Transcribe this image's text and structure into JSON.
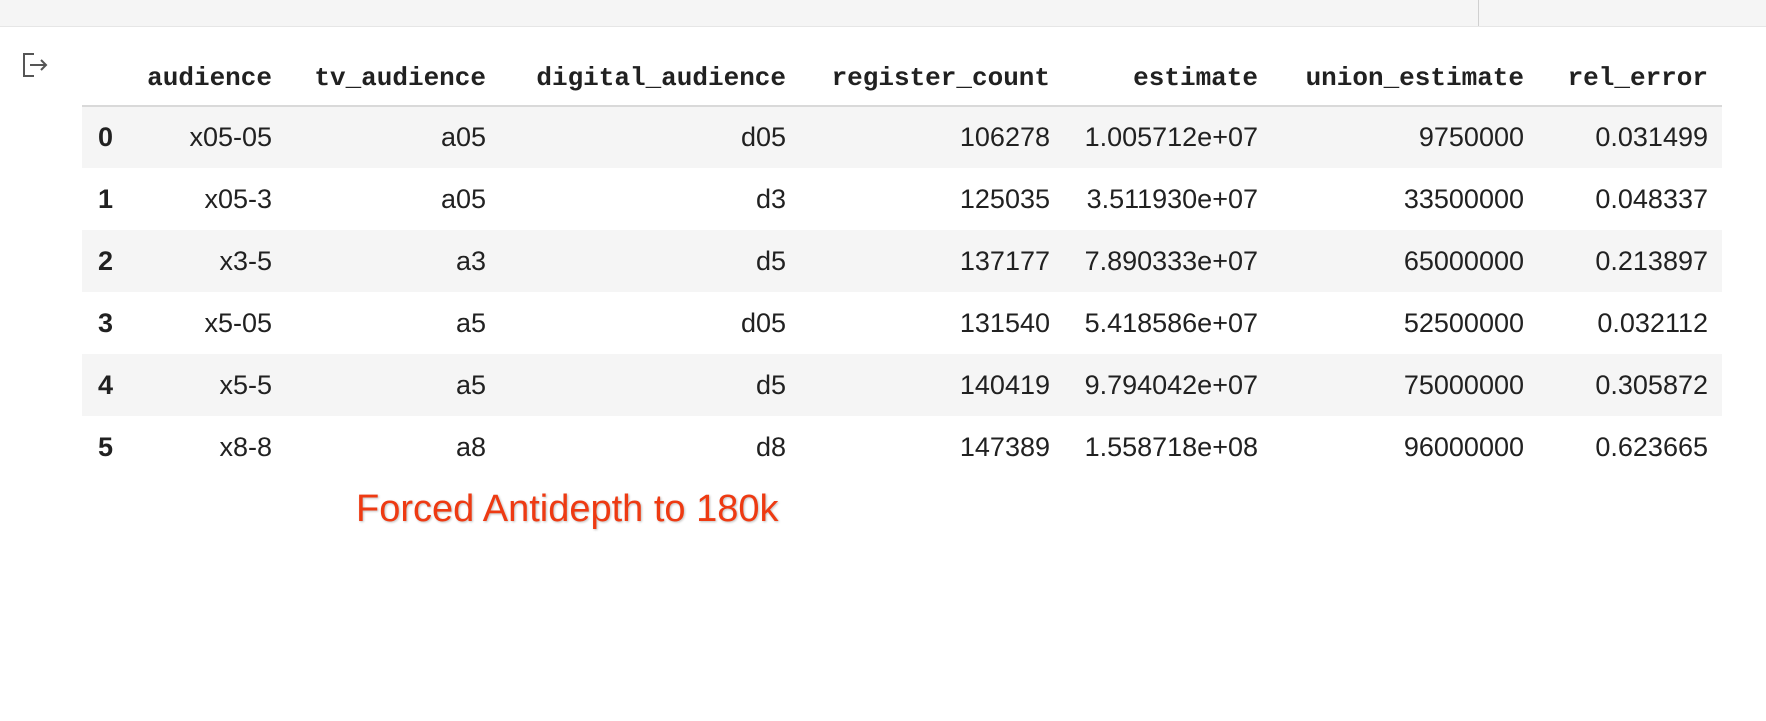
{
  "output": {
    "icon": "output-arrow-icon"
  },
  "table": {
    "columns": [
      "audience",
      "tv_audience",
      "digital_audience",
      "register_count",
      "estimate",
      "union_estimate",
      "rel_error"
    ],
    "rows": [
      {
        "index": "0",
        "cells": [
          "x05-05",
          "a05",
          "d05",
          "106278",
          "1.005712e+07",
          "9750000",
          "0.031499"
        ]
      },
      {
        "index": "1",
        "cells": [
          "x05-3",
          "a05",
          "d3",
          "125035",
          "3.511930e+07",
          "33500000",
          "0.048337"
        ]
      },
      {
        "index": "2",
        "cells": [
          "x3-5",
          "a3",
          "d5",
          "137177",
          "7.890333e+07",
          "65000000",
          "0.213897"
        ]
      },
      {
        "index": "3",
        "cells": [
          "x5-05",
          "a5",
          "d05",
          "131540",
          "5.418586e+07",
          "52500000",
          "0.032112"
        ]
      },
      {
        "index": "4",
        "cells": [
          "x5-5",
          "a5",
          "d5",
          "140419",
          "9.794042e+07",
          "75000000",
          "0.305872"
        ]
      },
      {
        "index": "5",
        "cells": [
          "x8-8",
          "a8",
          "d8",
          "147389",
          "1.558718e+08",
          "96000000",
          "0.623665"
        ]
      }
    ]
  },
  "annotation": {
    "text": "Forced Antidepth to 180k",
    "color": "#ee3a12"
  },
  "colors": {
    "row_stripe": "#f5f5f5",
    "text": "#212121"
  }
}
